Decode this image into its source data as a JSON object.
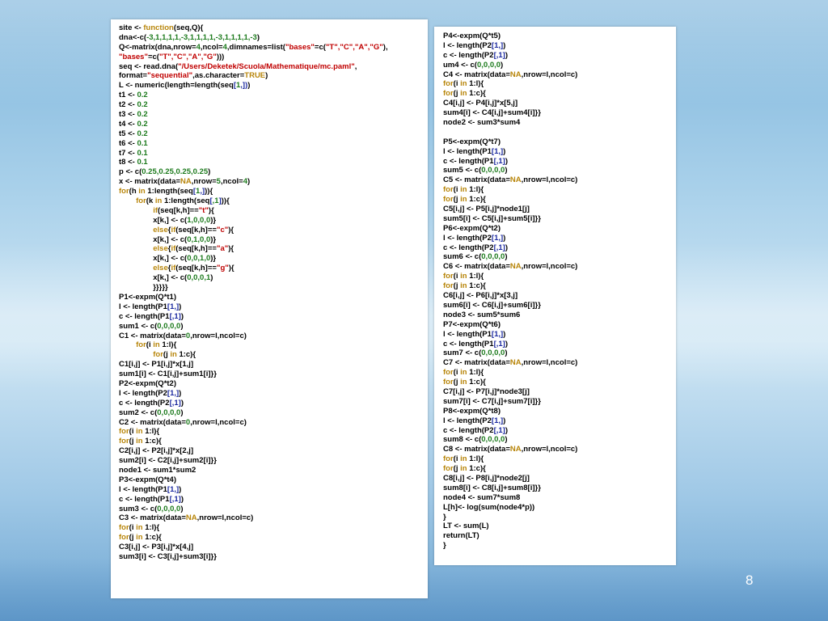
{
  "slide": {
    "page_number": "8",
    "colors": {
      "keyword": "#b8860b",
      "string": "#c00000",
      "number": "#1c7a1c",
      "bracket": "#1c2aa0",
      "text": "#000000"
    }
  },
  "left_code": [
    [
      {
        "t": "site <- "
      },
      {
        "t": "function",
        "c": "k"
      },
      {
        "t": "(seq,Q){"
      }
    ],
    [
      {
        "t": "dna<-c("
      },
      {
        "t": "-3,1,1,1,1,-3,1,1,1,1,-3,1,1,1,1,-3",
        "c": "n"
      },
      {
        "t": ")"
      }
    ],
    [
      {
        "t": "Q<-matrix(dna,nrow="
      },
      {
        "t": "4",
        "c": "n"
      },
      {
        "t": ",ncol="
      },
      {
        "t": "4",
        "c": "n"
      },
      {
        "t": ",dimnames=list("
      },
      {
        "t": "\"bases\"",
        "c": "s"
      },
      {
        "t": "=c("
      },
      {
        "t": "\"T\",\"C\",\"A\",\"G\"",
        "c": "s"
      },
      {
        "t": "),"
      }
    ],
    [
      {
        "t": "\"bases\"",
        "c": "s"
      },
      {
        "t": "=c("
      },
      {
        "t": "\"T\",\"C\",\"A\",\"G\"",
        "c": "s"
      },
      {
        "t": ")))"
      }
    ],
    [
      {
        "t": "seq <- read.dna("
      },
      {
        "t": "\"/Users/Deketek/Scuola/Mathematique/mc.paml\"",
        "c": "s"
      },
      {
        "t": ","
      }
    ],
    [
      {
        "t": "format="
      },
      {
        "t": "\"sequential\"",
        "c": "s"
      },
      {
        "t": ",as.character="
      },
      {
        "t": "TRUE",
        "c": "k"
      },
      {
        "t": ")"
      }
    ],
    [
      {
        "t": "L <- numeric(length=length(seq"
      },
      {
        "t": "[",
        "c": "b"
      },
      {
        "t": "1",
        "c": "n"
      },
      {
        "t": ",])",
        "c": "b"
      },
      {
        "t": ")"
      }
    ],
    [
      {
        "t": "t1 <- "
      },
      {
        "t": "0.2",
        "c": "n"
      }
    ],
    [
      {
        "t": "t2 <- "
      },
      {
        "t": "0.2",
        "c": "n"
      }
    ],
    [
      {
        "t": "t3 <- "
      },
      {
        "t": "0.2",
        "c": "n"
      }
    ],
    [
      {
        "t": "t4 <- "
      },
      {
        "t": "0.2",
        "c": "n"
      }
    ],
    [
      {
        "t": "t5 <- "
      },
      {
        "t": "0.2",
        "c": "n"
      }
    ],
    [
      {
        "t": "t6 <- "
      },
      {
        "t": "0.1",
        "c": "n"
      }
    ],
    [
      {
        "t": "t7 <- "
      },
      {
        "t": "0.1",
        "c": "n"
      }
    ],
    [
      {
        "t": "t8 <- "
      },
      {
        "t": "0.1",
        "c": "n"
      }
    ],
    [
      {
        "t": "p <- c("
      },
      {
        "t": "0.25,0.25,0.25,0.25",
        "c": "n"
      },
      {
        "t": ")"
      }
    ],
    [
      {
        "t": "x <- matrix(data="
      },
      {
        "t": "NA",
        "c": "k"
      },
      {
        "t": ",nrow="
      },
      {
        "t": "5",
        "c": "n"
      },
      {
        "t": ",ncol="
      },
      {
        "t": "4",
        "c": "n"
      },
      {
        "t": ")"
      }
    ],
    [
      {
        "t": "for",
        "c": "k"
      },
      {
        "t": "(h "
      },
      {
        "t": "in",
        "c": "k"
      },
      {
        "t": " 1:length(seq"
      },
      {
        "t": "[",
        "c": "b"
      },
      {
        "t": "1",
        "c": "n"
      },
      {
        "t": ",]",
        "c": "b"
      },
      {
        "t": ")){"
      }
    ],
    [
      {
        "t": "        "
      },
      {
        "t": "for",
        "c": "k"
      },
      {
        "t": "(k "
      },
      {
        "t": "in",
        "c": "k"
      },
      {
        "t": " 1:length(seq"
      },
      {
        "t": "[",
        "c": "b"
      },
      {
        "t": ",1",
        "c": "n"
      },
      {
        "t": "]",
        "c": "b"
      },
      {
        "t": ")){"
      }
    ],
    [
      {
        "t": "                "
      },
      {
        "t": "if",
        "c": "k"
      },
      {
        "t": "(seq[k,h]=="
      },
      {
        "t": "\"t\"",
        "c": "s"
      },
      {
        "t": "){"
      }
    ],
    [
      {
        "t": "                x[k,] <- c("
      },
      {
        "t": "1,0,0,0",
        "c": "n"
      },
      {
        "t": ")}"
      }
    ],
    [
      {
        "t": "                "
      },
      {
        "t": "else",
        "c": "k"
      },
      {
        "t": "{"
      },
      {
        "t": "if",
        "c": "k"
      },
      {
        "t": "(seq[k,h]=="
      },
      {
        "t": "\"c\"",
        "c": "s"
      },
      {
        "t": "){"
      }
    ],
    [
      {
        "t": "                x[k,] <- c("
      },
      {
        "t": "0,1,0,0",
        "c": "n"
      },
      {
        "t": ")}"
      }
    ],
    [
      {
        "t": "                "
      },
      {
        "t": "else",
        "c": "k"
      },
      {
        "t": "{"
      },
      {
        "t": "if",
        "c": "k"
      },
      {
        "t": "(seq[k,h]=="
      },
      {
        "t": "\"a\"",
        "c": "s"
      },
      {
        "t": "){"
      }
    ],
    [
      {
        "t": "                x[k,] <- c("
      },
      {
        "t": "0,0,1,0",
        "c": "n"
      },
      {
        "t": ")}"
      }
    ],
    [
      {
        "t": "                "
      },
      {
        "t": "else",
        "c": "k"
      },
      {
        "t": "{"
      },
      {
        "t": "if",
        "c": "k"
      },
      {
        "t": "(seq[k,h]=="
      },
      {
        "t": "\"g\"",
        "c": "s"
      },
      {
        "t": "){"
      }
    ],
    [
      {
        "t": "                x[k,] <- c("
      },
      {
        "t": "0,0,0,1",
        "c": "n"
      },
      {
        "t": ")"
      }
    ],
    [
      {
        "t": "                }}}}}"
      }
    ],
    [
      {
        "t": "P1<-expm(Q*t1)"
      }
    ],
    [
      {
        "t": "l <- length(P1"
      },
      {
        "t": "[1,]",
        "c": "b"
      },
      {
        "t": ")"
      }
    ],
    [
      {
        "t": "c <- length(P1"
      },
      {
        "t": "[,1]",
        "c": "b"
      },
      {
        "t": ")"
      }
    ],
    [
      {
        "t": "sum1 <- c("
      },
      {
        "t": "0,0,0,0",
        "c": "n"
      },
      {
        "t": ")"
      }
    ],
    [
      {
        "t": "C1 <- matrix(data="
      },
      {
        "t": "0",
        "c": "n"
      },
      {
        "t": ",nrow=l,ncol=c)"
      }
    ],
    [
      {
        "t": "        "
      },
      {
        "t": "for",
        "c": "k"
      },
      {
        "t": "(i "
      },
      {
        "t": "in",
        "c": "k"
      },
      {
        "t": " 1:l){"
      }
    ],
    [
      {
        "t": "                "
      },
      {
        "t": "for",
        "c": "k"
      },
      {
        "t": "(j "
      },
      {
        "t": "in",
        "c": "k"
      },
      {
        "t": " 1:c){"
      }
    ],
    [
      {
        "t": "C1[i,j] <- P1[i,j]*x[1,j]"
      }
    ],
    [
      {
        "t": "sum1[i] <- C1[i,j]+sum1[i]}}"
      }
    ],
    [
      {
        "t": "P2<-expm(Q*t2)"
      }
    ],
    [
      {
        "t": "l <- length(P2"
      },
      {
        "t": "[1,]",
        "c": "b"
      },
      {
        "t": ")"
      }
    ],
    [
      {
        "t": "c <- length(P2"
      },
      {
        "t": "[,1]",
        "c": "b"
      },
      {
        "t": ")"
      }
    ],
    [
      {
        "t": "sum2 <- c("
      },
      {
        "t": "0,0,0,0",
        "c": "n"
      },
      {
        "t": ")"
      }
    ],
    [
      {
        "t": "C2 <- matrix(data="
      },
      {
        "t": "0",
        "c": "n"
      },
      {
        "t": ",nrow=l,ncol=c)"
      }
    ],
    [
      {
        "t": "for",
        "c": "k"
      },
      {
        "t": "(i "
      },
      {
        "t": "in",
        "c": "k"
      },
      {
        "t": " 1:l){"
      }
    ],
    [
      {
        "t": "for",
        "c": "k"
      },
      {
        "t": "(j "
      },
      {
        "t": "in",
        "c": "k"
      },
      {
        "t": " 1:c){"
      }
    ],
    [
      {
        "t": "C2[i,j] <- P2[i,j]*x[2,j]"
      }
    ],
    [
      {
        "t": "sum2[i] <- C2[i,j]+sum2[i]}}"
      }
    ],
    [
      {
        "t": "node1 <- sum1*sum2"
      }
    ],
    [
      {
        "t": "P3<-expm(Q*t4)"
      }
    ],
    [
      {
        "t": "l <- length(P1"
      },
      {
        "t": "[1,]",
        "c": "b"
      },
      {
        "t": ")"
      }
    ],
    [
      {
        "t": "c <- length(P1"
      },
      {
        "t": "[,1]",
        "c": "b"
      },
      {
        "t": ")"
      }
    ],
    [
      {
        "t": "sum3 <- c("
      },
      {
        "t": "0,0,0,0",
        "c": "n"
      },
      {
        "t": ")"
      }
    ],
    [
      {
        "t": "C3 <- matrix(data="
      },
      {
        "t": "NA",
        "c": "k"
      },
      {
        "t": ",nrow=l,ncol=c)"
      }
    ],
    [
      {
        "t": "for",
        "c": "k"
      },
      {
        "t": "(i "
      },
      {
        "t": "in",
        "c": "k"
      },
      {
        "t": " 1:l){"
      }
    ],
    [
      {
        "t": "for",
        "c": "k"
      },
      {
        "t": "(j "
      },
      {
        "t": "in",
        "c": "k"
      },
      {
        "t": " 1:c){"
      }
    ],
    [
      {
        "t": "C3[i,j] <- P3[i,j]*x[4,j]"
      }
    ],
    [
      {
        "t": "sum3[i] <- C3[i,j]+sum3[i]}}"
      }
    ]
  ],
  "right_code": [
    [
      {
        "t": "P4<-expm(Q*t5)"
      }
    ],
    [
      {
        "t": "l <- length(P2"
      },
      {
        "t": "[1,]",
        "c": "b"
      },
      {
        "t": ")"
      }
    ],
    [
      {
        "t": "c <- length(P2"
      },
      {
        "t": "[,1]",
        "c": "b"
      },
      {
        "t": ")"
      }
    ],
    [
      {
        "t": "um4 <- c("
      },
      {
        "t": "0,0,0,0",
        "c": "n"
      },
      {
        "t": ")"
      }
    ],
    [
      {
        "t": "C4 <- matrix(data="
      },
      {
        "t": "NA",
        "c": "k"
      },
      {
        "t": ",nrow=l,ncol=c)"
      }
    ],
    [
      {
        "t": "for",
        "c": "k"
      },
      {
        "t": "(i "
      },
      {
        "t": "in",
        "c": "k"
      },
      {
        "t": " 1:l){"
      }
    ],
    [
      {
        "t": "for",
        "c": "k"
      },
      {
        "t": "(j "
      },
      {
        "t": "in",
        "c": "k"
      },
      {
        "t": " 1:c){"
      }
    ],
    [
      {
        "t": "C4[i,j] <- P4[i,j]*x[5,j]"
      }
    ],
    [
      {
        "t": "sum4[i] <- C4[i,j]+sum4[i]}}"
      }
    ],
    [
      {
        "t": "node2 <- sum3*sum4"
      }
    ],
    [
      {
        "t": " "
      }
    ],
    [
      {
        "t": "P5<-expm(Q*t7)"
      }
    ],
    [
      {
        "t": "l <- length(P1"
      },
      {
        "t": "[1,]",
        "c": "b"
      },
      {
        "t": ")"
      }
    ],
    [
      {
        "t": "c <- length(P1"
      },
      {
        "t": "[,1]",
        "c": "b"
      },
      {
        "t": ")"
      }
    ],
    [
      {
        "t": "sum5 <- c("
      },
      {
        "t": "0,0,0,0",
        "c": "n"
      },
      {
        "t": ")"
      }
    ],
    [
      {
        "t": "C5 <- matrix(data="
      },
      {
        "t": "NA",
        "c": "k"
      },
      {
        "t": ",nrow=l,ncol=c)"
      }
    ],
    [
      {
        "t": "for",
        "c": "k"
      },
      {
        "t": "(i "
      },
      {
        "t": "in",
        "c": "k"
      },
      {
        "t": " 1:l){"
      }
    ],
    [
      {
        "t": "for",
        "c": "k"
      },
      {
        "t": "(j "
      },
      {
        "t": "in",
        "c": "k"
      },
      {
        "t": " 1:c){"
      }
    ],
    [
      {
        "t": "C5[i,j] <- P5[i,j]*node1[j]"
      }
    ],
    [
      {
        "t": "sum5[i] <- C5[i,j]+sum5[i]}}"
      }
    ],
    [
      {
        "t": "P6<-expm(Q*t2)"
      }
    ],
    [
      {
        "t": "l <- length(P2"
      },
      {
        "t": "[1,]",
        "c": "b"
      },
      {
        "t": ")"
      }
    ],
    [
      {
        "t": "c <- length(P2"
      },
      {
        "t": "[,1]",
        "c": "b"
      },
      {
        "t": ")"
      }
    ],
    [
      {
        "t": "sum6 <- c("
      },
      {
        "t": "0,0,0,0",
        "c": "n"
      },
      {
        "t": ")"
      }
    ],
    [
      {
        "t": "C6 <- matrix(data="
      },
      {
        "t": "NA",
        "c": "k"
      },
      {
        "t": ",nrow=l,ncol=c)"
      }
    ],
    [
      {
        "t": "for",
        "c": "k"
      },
      {
        "t": "(i "
      },
      {
        "t": "in",
        "c": "k"
      },
      {
        "t": " 1:l){"
      }
    ],
    [
      {
        "t": "for",
        "c": "k"
      },
      {
        "t": "(j "
      },
      {
        "t": "in",
        "c": "k"
      },
      {
        "t": " 1:c){"
      }
    ],
    [
      {
        "t": "C6[i,j] <- P6[i,j]*x[3,j]"
      }
    ],
    [
      {
        "t": "sum6[i] <- C6[i,j]+sum6[i]}}"
      }
    ],
    [
      {
        "t": "node3 <- sum5*sum6"
      }
    ],
    [
      {
        "t": "P7<-expm(Q*t6)"
      }
    ],
    [
      {
        "t": "l <- length(P1"
      },
      {
        "t": "[1,]",
        "c": "b"
      },
      {
        "t": ")"
      }
    ],
    [
      {
        "t": "c <- length(P1"
      },
      {
        "t": "[,1]",
        "c": "b"
      },
      {
        "t": ")"
      }
    ],
    [
      {
        "t": "sum7 <- c("
      },
      {
        "t": "0,0,0,0",
        "c": "n"
      },
      {
        "t": ")"
      }
    ],
    [
      {
        "t": "C7 <- matrix(data="
      },
      {
        "t": "NA",
        "c": "k"
      },
      {
        "t": ",nrow=l,ncol=c)"
      }
    ],
    [
      {
        "t": "for",
        "c": "k"
      },
      {
        "t": "(i "
      },
      {
        "t": "in",
        "c": "k"
      },
      {
        "t": " 1:l){"
      }
    ],
    [
      {
        "t": "for",
        "c": "k"
      },
      {
        "t": "(j "
      },
      {
        "t": "in",
        "c": "k"
      },
      {
        "t": " 1:c){"
      }
    ],
    [
      {
        "t": "C7[i,j] <- P7[i,j]*node3[j]"
      }
    ],
    [
      {
        "t": "sum7[i] <- C7[i,j]+sum7[i]}}"
      }
    ],
    [
      {
        "t": "P8<-expm(Q*t8)"
      }
    ],
    [
      {
        "t": "l <- length(P2"
      },
      {
        "t": "[1,]",
        "c": "b"
      },
      {
        "t": ")"
      }
    ],
    [
      {
        "t": "c <- length(P2"
      },
      {
        "t": "[,1]",
        "c": "b"
      },
      {
        "t": ")"
      }
    ],
    [
      {
        "t": "sum8 <- c("
      },
      {
        "t": "0,0,0,0",
        "c": "n"
      },
      {
        "t": ")"
      }
    ],
    [
      {
        "t": "C8 <- matrix(data="
      },
      {
        "t": "NA",
        "c": "k"
      },
      {
        "t": ",nrow=l,ncol=c)"
      }
    ],
    [
      {
        "t": "for",
        "c": "k"
      },
      {
        "t": "(i "
      },
      {
        "t": "in",
        "c": "k"
      },
      {
        "t": " 1:l){"
      }
    ],
    [
      {
        "t": "for",
        "c": "k"
      },
      {
        "t": "(j "
      },
      {
        "t": "in",
        "c": "k"
      },
      {
        "t": " 1:c){"
      }
    ],
    [
      {
        "t": "C8[i,j] <- P8[i,j]*node2[j]"
      }
    ],
    [
      {
        "t": "sum8[i] <- C8[i,j]+sum8[i]}}"
      }
    ],
    [
      {
        "t": "node4 <- sum7*sum8"
      }
    ],
    [
      {
        "t": "L[h]<- log(sum(node4*p))"
      }
    ],
    [
      {
        "t": "}"
      }
    ],
    [
      {
        "t": "LT <- sum(L)"
      }
    ],
    [
      {
        "t": "return(LT)"
      }
    ],
    [
      {
        "t": "}"
      }
    ]
  ]
}
